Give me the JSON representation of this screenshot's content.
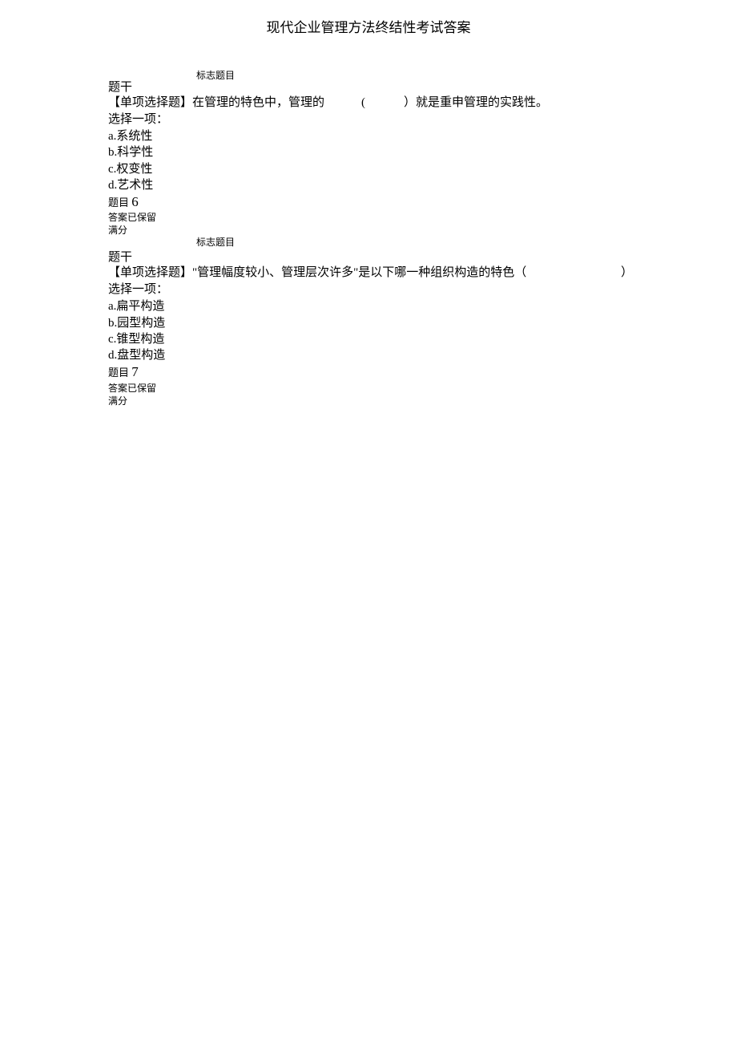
{
  "page_title": "现代企业管理方法终结性考试答案",
  "block1": {
    "flag_label": "标志题目",
    "stem_label": "题干",
    "q_type": "【单项选择题】",
    "q_text_before": "在管理的特色中，管理的",
    "q_text_after": "）就是重申管理的实践性。",
    "select_label": "选择一项：",
    "options": [
      {
        "letter": "a.",
        "text": "系统性"
      },
      {
        "letter": "b.",
        "text": "科学性"
      },
      {
        "letter": "c.",
        "text": "权变性"
      },
      {
        "letter": "d.",
        "text": "艺术性"
      }
    ],
    "qnum_label": "题目",
    "qnum": "6",
    "saved": "答案已保留",
    "full": "满分"
  },
  "block2": {
    "flag_label": "标志题目",
    "stem_label": "题干",
    "q_type": "【单项选择题】",
    "q_text_main": "\"管理幅度较小、管理层次许多\"是以下哪一种组织构造的特色（",
    "q_text_close": "）",
    "select_label": "选择一项：",
    "options": [
      {
        "letter": "a.",
        "text": "扁平构造"
      },
      {
        "letter": "b.",
        "text": "园型构造"
      },
      {
        "letter": "c.",
        "text": "锥型构造"
      },
      {
        "letter": "d.",
        "text": "盘型构造"
      }
    ],
    "qnum_label": "题目",
    "qnum": "7",
    "saved": "答案已保留",
    "full": "满分"
  }
}
